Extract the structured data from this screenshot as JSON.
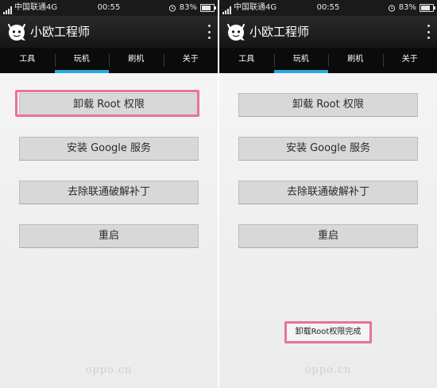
{
  "statusbar": {
    "carrier": "中国联通4G",
    "time": "00:55",
    "battery": "83%",
    "battery_level": 0.83
  },
  "app": {
    "title": "小欧工程师",
    "icons": {
      "logo": "robot-face-icon",
      "menu": "overflow-menu-icon"
    }
  },
  "tabs": [
    {
      "label": "工具",
      "active": false
    },
    {
      "label": "玩机",
      "active": true
    },
    {
      "label": "刷机",
      "active": false
    },
    {
      "label": "关于",
      "active": false
    }
  ],
  "actions": [
    {
      "label": "卸载 Root 权限"
    },
    {
      "label": "安装 Google 服务"
    },
    {
      "label": "去除联通破解补丁"
    },
    {
      "label": "重启"
    }
  ],
  "toast": {
    "message": "卸载Root权限完成"
  },
  "watermark": "oppo.cn",
  "colors": {
    "accent": "#29a8e0",
    "highlight": "#e8729a",
    "button_bg": "#d8d8d8"
  }
}
